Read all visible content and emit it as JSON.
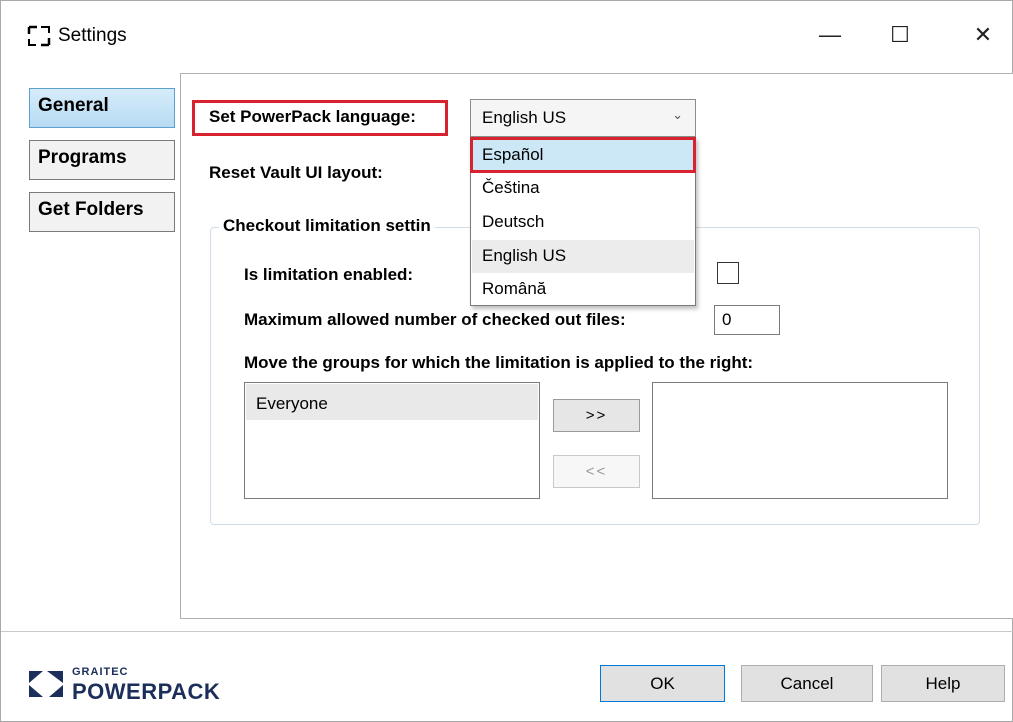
{
  "window": {
    "title": "Settings",
    "minimize": "—",
    "maximize": "☐",
    "close": "✕"
  },
  "nav": {
    "items": [
      {
        "label": "General",
        "active": true
      },
      {
        "label": "Programs",
        "active": false
      },
      {
        "label": "Get Folders",
        "active": false
      }
    ]
  },
  "general": {
    "language_label": "Set PowerPack language:",
    "language_value": "English US",
    "reset_label": "Reset Vault UI layout:",
    "checkout_group_title": "Checkout limitation settin",
    "limitation_enabled_label": "Is limitation enabled:",
    "limitation_enabled": false,
    "max_files_label": "Maximum allowed number of checked out files:",
    "max_files_value": "0",
    "move_groups_label": "Move the groups for which the limitation is applied to the right:",
    "available_groups": [
      "Everyone"
    ],
    "applied_groups": [],
    "move_right_label": ">>",
    "move_left_label": "<<"
  },
  "language_dropdown": {
    "options": [
      "Español",
      "Čeština",
      "Deutsch",
      "English US",
      "Română"
    ],
    "hovered": "Español",
    "current": "English US"
  },
  "footer": {
    "brand_top": "GRAITEC",
    "brand_name": "POWERPACK",
    "ok_label": "OK",
    "cancel_label": "Cancel",
    "help_label": "Help"
  },
  "colors": {
    "highlight": "#d6232f",
    "brand": "#1b2f5a",
    "selection": "#cce8f6"
  }
}
